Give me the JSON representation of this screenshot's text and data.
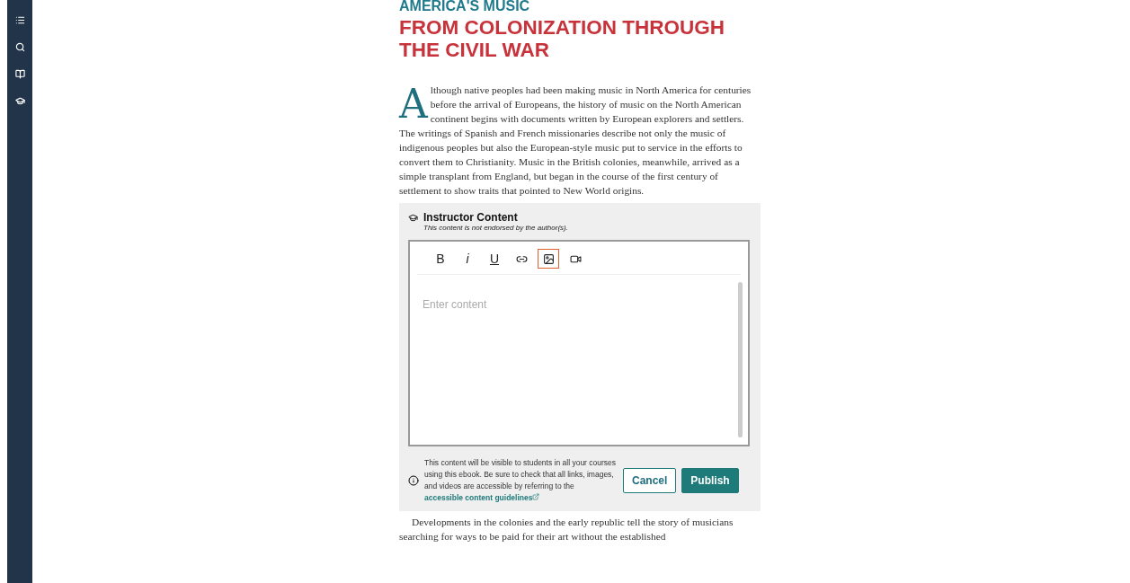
{
  "sidebar": {
    "items": [
      {
        "kind": "list",
        "selected": false
      },
      {
        "kind": "search",
        "selected": false
      },
      {
        "kind": "book",
        "selected": false
      },
      {
        "kind": "cap",
        "selected": false
      }
    ]
  },
  "article": {
    "kicker": "AMERICA'S MUSIC",
    "title": "FROM COLONIZATION THROUGH THE CIVIL WAR",
    "drop_cap": "A",
    "intro": "lthough native peoples had been making music in North America for centuries before the arrival of Europeans, the history of music on the North American continent begins with documents written by European explorers and settlers. The writings of Spanish and French missionaries describe not only the music of indigenous peoples but also the European-style music put to service in the efforts to convert them to Christianity. Music in the British colonies, meanwhile, arrived as a simple transplant from England, but began in the course of the first century of settlement to show traits that pointed to New World origins.",
    "after": "Developments in the colonies and the early republic tell the story of musicians searching for ways to be paid for their art without the established"
  },
  "instructor": {
    "title": "Instructor Content",
    "subtitle": "This content is not endorsed by the author(s).",
    "toolbar": [
      {
        "kind": "bold",
        "label": "B",
        "selected": false
      },
      {
        "kind": "italic",
        "label": "i",
        "selected": false
      },
      {
        "kind": "underline",
        "label": "U",
        "selected": false
      },
      {
        "kind": "link",
        "selected": false
      },
      {
        "kind": "image",
        "selected": true
      },
      {
        "kind": "video",
        "selected": false
      }
    ],
    "placeholder": "Enter content",
    "notice": "This content will be visible to students in all your courses using this ebook. Be sure to check that all links, images, and videos are accessible by referring to the",
    "notice_link": "accessible content guidelines",
    "buttons": [
      {
        "kind": "secondary",
        "label": "Cancel"
      },
      {
        "kind": "primary",
        "label": "Publish"
      }
    ]
  }
}
